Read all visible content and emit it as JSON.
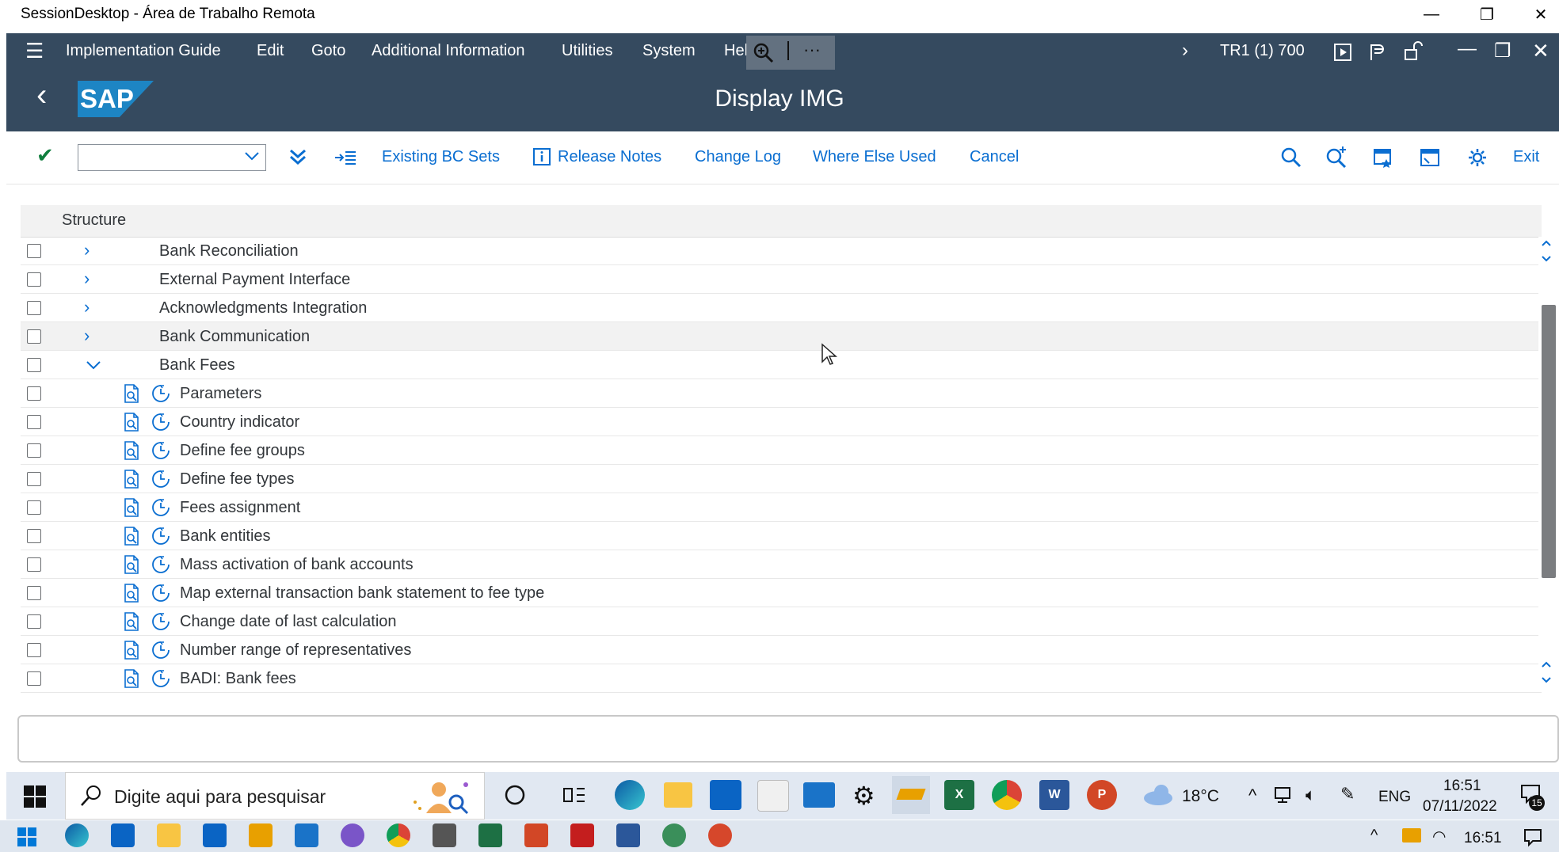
{
  "remote_window": {
    "title": "SessionDesktop - Área de Trabalho Remota",
    "controls": [
      "—",
      "❐",
      "✕"
    ]
  },
  "menubar": {
    "hamburger": "☰",
    "items": [
      "Implementation Guide",
      "Edit",
      "Goto",
      "Additional Information",
      "Utilities",
      "System",
      "Hel"
    ],
    "more": "···",
    "system_info": "TR1 (1) 700"
  },
  "title_bar": {
    "back": "‹",
    "logo_text": "SAP",
    "title": "Display IMG"
  },
  "toolbar": {
    "enter_icon": "✔",
    "command_field_value": "",
    "buttons": [
      "Existing BC Sets",
      "Release Notes",
      "Change Log",
      "Where Else Used",
      "Cancel"
    ],
    "exit_label": "Exit"
  },
  "tree": {
    "header": "Structure",
    "nodes": [
      {
        "label": "Bank Reconciliation",
        "expander": "›"
      },
      {
        "label": "External Payment Interface",
        "expander": "›"
      },
      {
        "label": "Acknowledgments Integration",
        "expander": "›"
      },
      {
        "label": "Bank Communication",
        "expander": "›"
      },
      {
        "label": "Bank Fees",
        "expander": "⌄"
      }
    ],
    "activities": [
      "Parameters",
      "Country indicator",
      "Define fee groups",
      "Define fee types",
      "Fees assignment",
      "Bank entities",
      "Mass activation of bank accounts",
      "Map external transaction bank statement to fee type",
      "Change date of last calculation",
      "Number range of representatives",
      "BADI: Bank fees"
    ]
  },
  "remote_taskbar": {
    "search_placeholder": "Digite aqui para pesquisar",
    "weather": "18°C",
    "language": "ENG",
    "time": "16:51",
    "date": "07/11/2022",
    "notifications": "15"
  },
  "local_taskbar": {
    "time": "16:51"
  },
  "colors": {
    "shell": "#354a5f",
    "accent": "#0a6ed1",
    "scroll_thumb": "#7b7d80"
  }
}
